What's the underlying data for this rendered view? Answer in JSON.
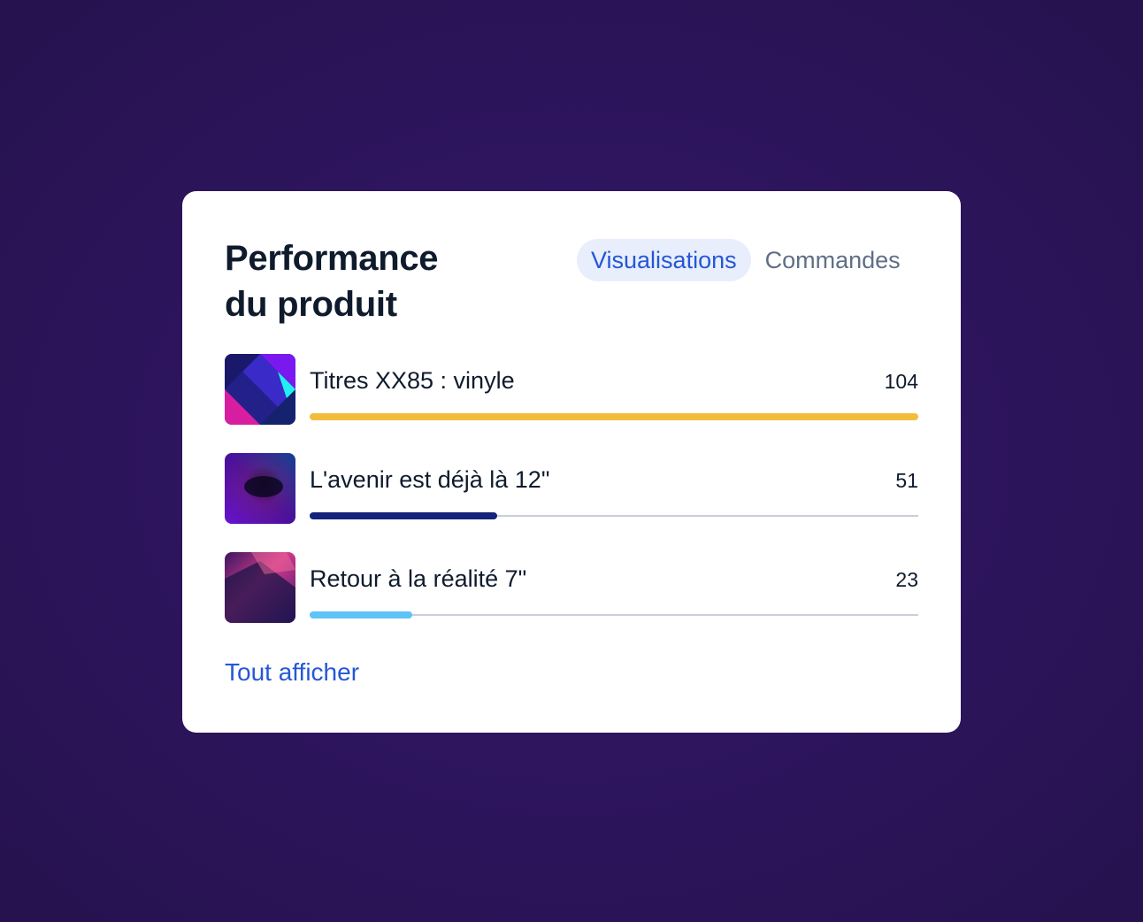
{
  "card": {
    "title_line1": "Performance",
    "title_line2": "du produit",
    "tabs": [
      {
        "label": "Visualisations",
        "active": true
      },
      {
        "label": "Commandes",
        "active": false
      }
    ],
    "items": [
      {
        "name": "Titres XX85 : vinyle",
        "value": "104",
        "bar_fraction": 1.0,
        "bar_color": "#f2bd3d"
      },
      {
        "name": "L'avenir est déjà là 12\"",
        "value": "51",
        "bar_fraction": 0.308,
        "bar_color": "#15237a"
      },
      {
        "name": "Retour à la réalité 7\"",
        "value": "23",
        "bar_fraction": 0.168,
        "bar_color": "#5ec3f7"
      }
    ],
    "view_all_label": "Tout afficher"
  },
  "colors": {
    "accent": "#2557d6",
    "tab_active_bg": "#e8eefb",
    "background": "#2e155e"
  }
}
